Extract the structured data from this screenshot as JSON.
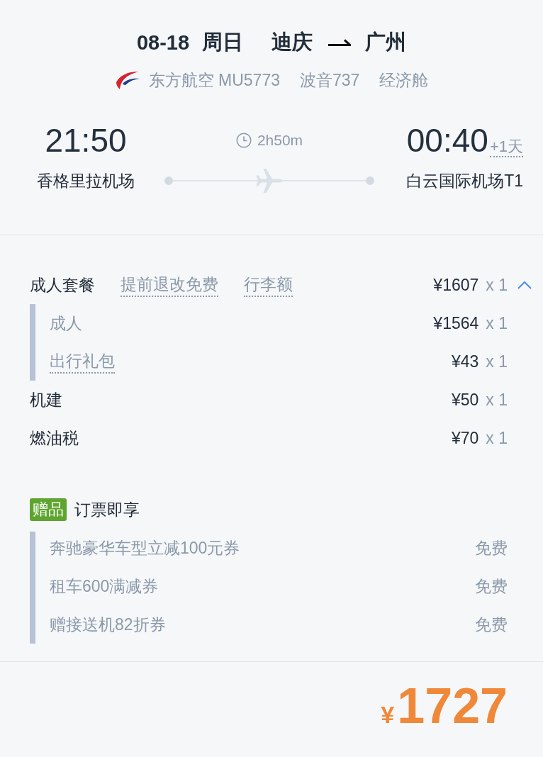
{
  "header": {
    "date": "08-18",
    "weekday": "周日",
    "origin": "迪庆",
    "destination": "广州"
  },
  "flight_info": {
    "airline_flight": "东方航空 MU5773",
    "aircraft": "波音737",
    "cabin": "经济舱"
  },
  "departure": {
    "time": "21:50",
    "airport": "香格里拉机场"
  },
  "duration": "2h50m",
  "arrival": {
    "time": "00:40",
    "day_offset": "+1天",
    "airport": "白云国际机场T1"
  },
  "price_items": [
    {
      "kind": "group",
      "label": "成人套餐",
      "tags": [
        "提前退改免费",
        "行李额"
      ],
      "price": "¥1607",
      "quantity": "x 1",
      "expanded": true,
      "children": [
        {
          "kind": "plain",
          "label": "成人",
          "price": "¥1564",
          "quantity": "x 1"
        },
        {
          "kind": "link",
          "label": "出行礼包",
          "price": "¥43",
          "quantity": "x 1"
        }
      ]
    },
    {
      "kind": "fee",
      "label": "机建",
      "price": "¥50",
      "quantity": "x 1"
    },
    {
      "kind": "fee",
      "label": "燃油税",
      "price": "¥70",
      "quantity": "x 1"
    }
  ],
  "gift": {
    "badge": "赠品",
    "title": "订票即享",
    "items": [
      {
        "label": "奔驰豪华车型立减100元券",
        "value": "免费"
      },
      {
        "label": "租车600满减券",
        "value": "免费"
      },
      {
        "label": "赠接送机82折券",
        "value": "免费"
      }
    ]
  },
  "total": {
    "currency": "¥",
    "amount": "1727"
  }
}
